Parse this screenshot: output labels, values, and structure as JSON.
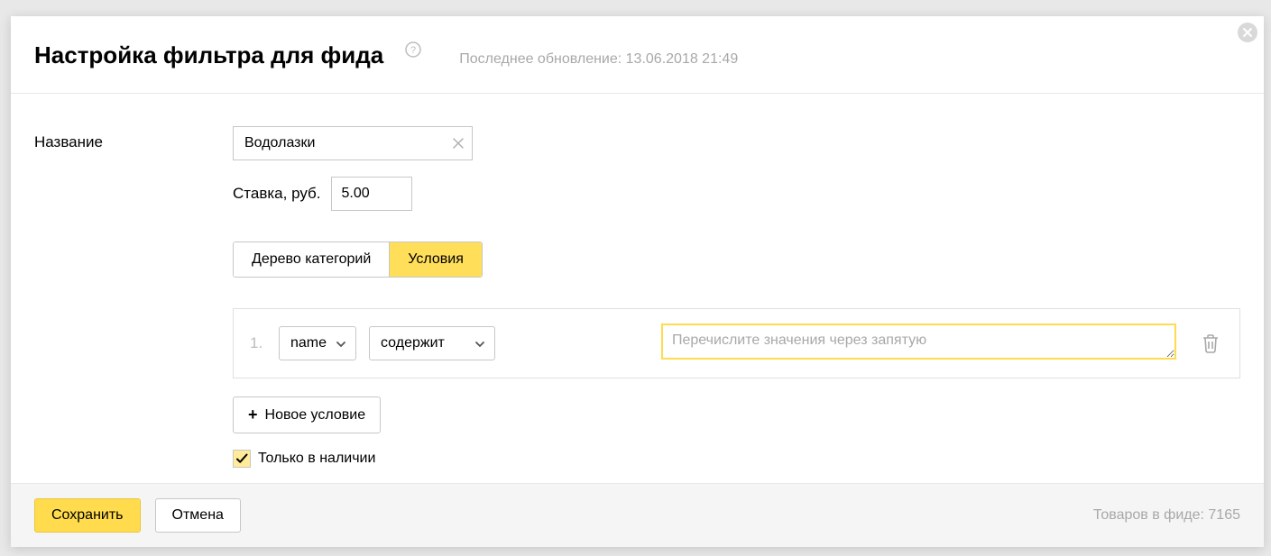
{
  "header": {
    "title": "Настройка фильтра для фида",
    "last_updated": "Последнее обновление: 13.06.2018 21:49"
  },
  "form": {
    "name_label": "Название",
    "name_value": "Водолазки",
    "bid_label": "Ставка, руб.",
    "bid_value": "5.00"
  },
  "tabs": {
    "tree": "Дерево категорий",
    "conditions": "Условия"
  },
  "condition": {
    "index": "1.",
    "field": "name",
    "operator": "содержит",
    "values_placeholder": "Перечислите значения через запятую"
  },
  "add_condition_label": "Новое условие",
  "only_in_stock_label": "Только в наличии",
  "only_in_stock_checked": true,
  "footer": {
    "save": "Сохранить",
    "cancel": "Отмена",
    "feed_count": "Товаров в фиде: 7165"
  }
}
